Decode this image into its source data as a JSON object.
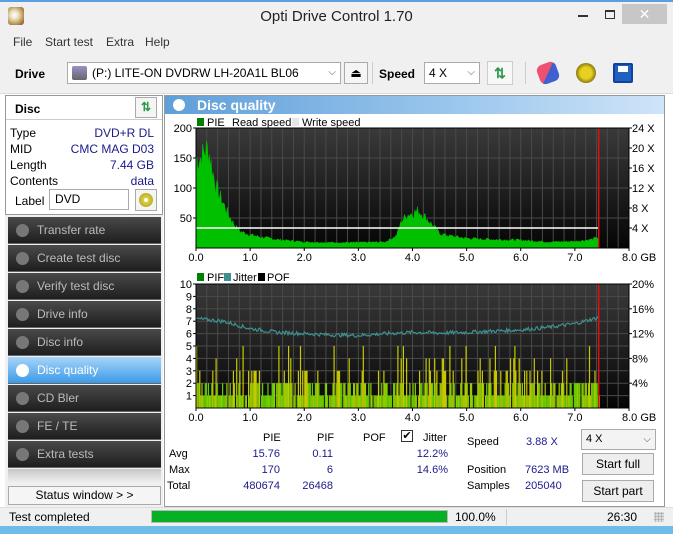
{
  "window": {
    "title": "Opti Drive Control 1.70",
    "close_glyph": "✕"
  },
  "menu": [
    "File",
    "Start test",
    "Extra",
    "Help"
  ],
  "toolbar": {
    "drive_label": "Drive",
    "drive_value": "(P:)  LITE-ON DVDRW LH-20A1L BL06",
    "speed_label": "Speed",
    "speed_value": "4 X"
  },
  "disc": {
    "header": "Disc",
    "rows": [
      {
        "key": "Type",
        "value": "DVD+R DL"
      },
      {
        "key": "MID",
        "value": "CMC MAG D03"
      },
      {
        "key": "Length",
        "value": "7.44 GB"
      },
      {
        "key": "Contents",
        "value": "data"
      }
    ],
    "label_key": "Label",
    "label_value": "DVD"
  },
  "nav": [
    {
      "label": "Transfer rate",
      "active": false
    },
    {
      "label": "Create test disc",
      "active": false
    },
    {
      "label": "Verify test disc",
      "active": false
    },
    {
      "label": "Drive info",
      "active": false
    },
    {
      "label": "Disc info",
      "active": false
    },
    {
      "label": "Disc quality",
      "active": true
    },
    {
      "label": "CD Bler",
      "active": false
    },
    {
      "label": "FE / TE",
      "active": false
    },
    {
      "label": "Extra tests",
      "active": false
    }
  ],
  "status_window_label": "Status window > >",
  "panel_title": "Disc quality",
  "chart_data": [
    {
      "type": "area",
      "title": "PIE / Read speed",
      "legend": [
        "PIE",
        "Read speed",
        "Write speed"
      ],
      "x_unit": "GB",
      "xlim": [
        0,
        8
      ],
      "x_ticks": [
        "0.0",
        "1.0",
        "2.0",
        "3.0",
        "4.0",
        "5.0",
        "6.0",
        "7.0",
        "8.0 GB"
      ],
      "ylim": [
        0,
        200
      ],
      "y_ticks": [
        "50",
        "100",
        "150",
        "200"
      ],
      "y2lim": [
        0,
        24
      ],
      "y2_ticks": [
        "4 X",
        "8 X",
        "12 X",
        "16 X",
        "20 X",
        "24 X"
      ],
      "end_marker_gb": 7.44,
      "read_speed_x": 4,
      "pie_profile": {
        "x": [
          0.0,
          0.05,
          0.1,
          0.15,
          0.2,
          0.25,
          0.3,
          0.35,
          0.4,
          0.5,
          0.6,
          0.7,
          0.8,
          1.0,
          1.2,
          1.5,
          2.0,
          2.5,
          3.0,
          3.5,
          3.7,
          3.8,
          3.9,
          4.0,
          4.1,
          4.2,
          4.3,
          4.4,
          4.5,
          4.7,
          5.0,
          5.5,
          6.0,
          6.5,
          7.0,
          7.3,
          7.44
        ],
        "y": [
          150,
          145,
          152,
          160,
          165,
          155,
          130,
          110,
          95,
          75,
          55,
          40,
          28,
          22,
          18,
          14,
          10,
          9,
          9,
          10,
          20,
          45,
          55,
          58,
          62,
          55,
          45,
          35,
          24,
          20,
          16,
          14,
          13,
          10,
          11,
          14,
          18
        ]
      }
    },
    {
      "type": "bar",
      "title": "PIF / Jitter / POF",
      "legend": [
        "PIF",
        "Jitter",
        "POF"
      ],
      "x_unit": "GB",
      "xlim": [
        0,
        8
      ],
      "x_ticks": [
        "0.0",
        "1.0",
        "2.0",
        "3.0",
        "4.0",
        "5.0",
        "6.0",
        "7.0",
        "8.0 GB"
      ],
      "ylim": [
        0,
        10
      ],
      "y_ticks": [
        "1",
        "2",
        "3",
        "4",
        "5",
        "6",
        "7",
        "8",
        "9",
        "10"
      ],
      "y2lim": [
        0,
        20
      ],
      "y2_ticks": [
        "4%",
        "8%",
        "12%",
        "16%",
        "20%"
      ],
      "end_marker_gb": 7.44,
      "jitter_profile": {
        "x": [
          0,
          0.5,
          1.0,
          1.5,
          2.0,
          2.5,
          3.0,
          3.5,
          4.0,
          4.5,
          5.0,
          5.5,
          6.0,
          6.5,
          7.0,
          7.44
        ],
        "y": [
          14.4,
          14.0,
          12.8,
          12.2,
          12.0,
          11.8,
          11.7,
          12.0,
          12.2,
          12.1,
          12.2,
          12.4,
          12.6,
          13.0,
          13.6,
          14.6
        ]
      }
    }
  ],
  "stats": {
    "headers": [
      "PIE",
      "PIF",
      "POF",
      "Jitter"
    ],
    "jitter_checked": true,
    "rows": [
      {
        "label": "Avg",
        "pie": "15.76",
        "pif": "0.11",
        "pof": "",
        "jitter": "12.2%"
      },
      {
        "label": "Max",
        "pie": "170",
        "pif": "6",
        "pof": "",
        "jitter": "14.6%"
      },
      {
        "label": "Total",
        "pie": "480674",
        "pif": "26468",
        "pof": "",
        "jitter": ""
      }
    ],
    "speed_label": "Speed",
    "speed_value": "3.88 X",
    "position_label": "Position",
    "position_value": "7623 MB",
    "samples_label": "Samples",
    "samples_value": "205040",
    "speed_select": "4 X",
    "start_full": "Start full",
    "start_part": "Start part"
  },
  "statusbar": {
    "text": "Test completed",
    "progress_percent": 100,
    "progress_text": "100.0%",
    "time": "26:30"
  }
}
